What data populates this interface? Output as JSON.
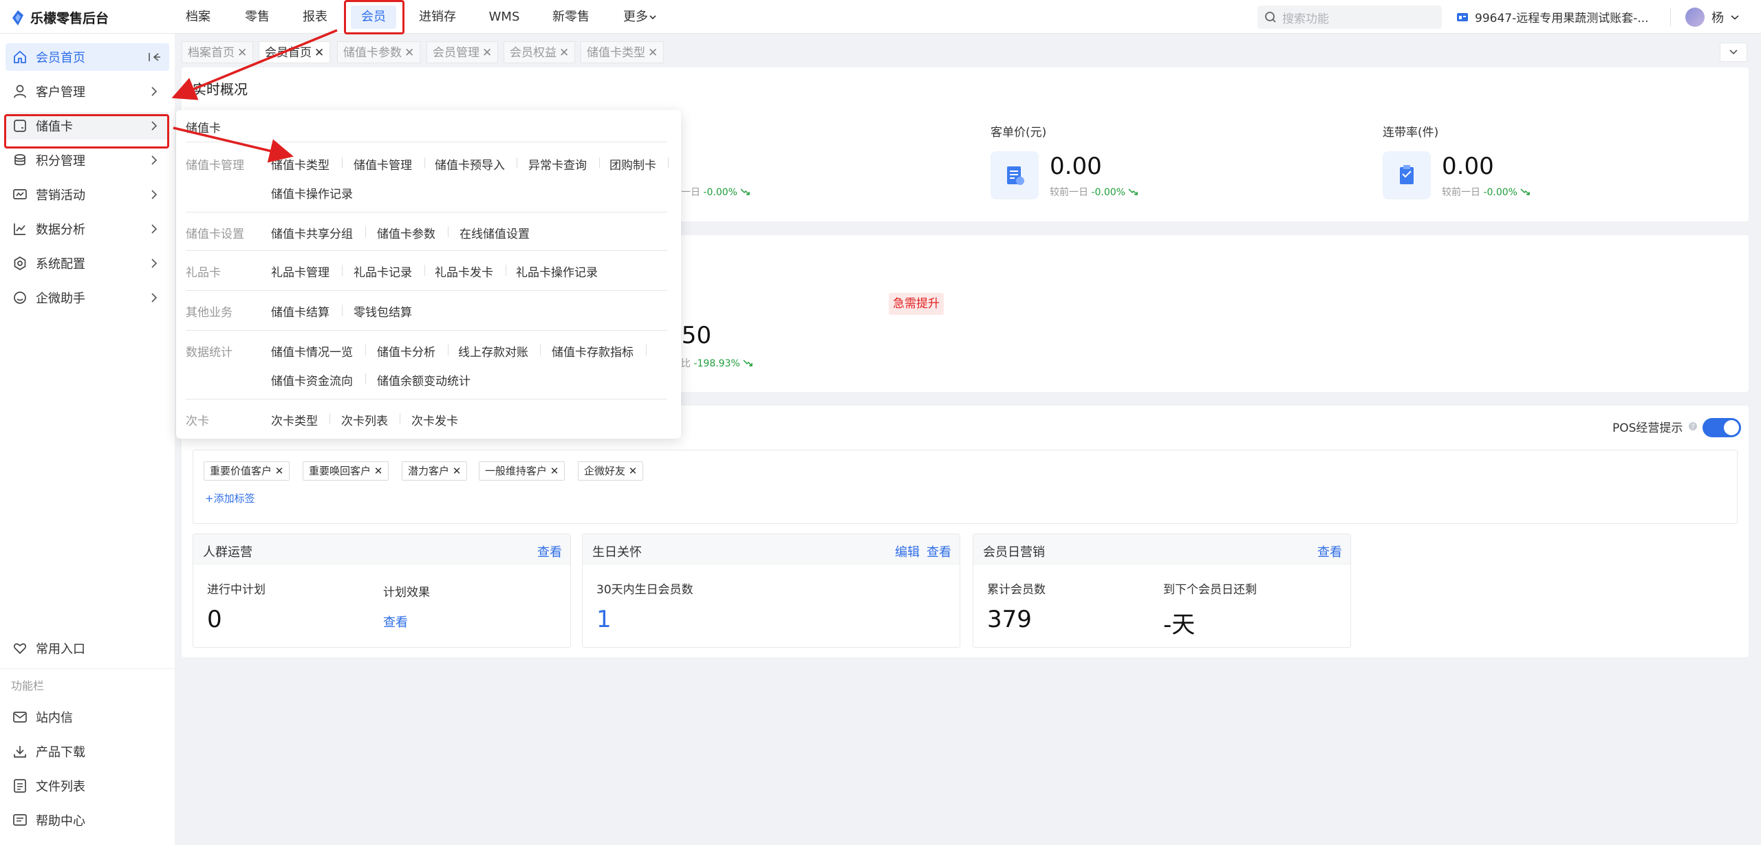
{
  "app": {
    "title": "乐檬零售后台"
  },
  "topnav": {
    "items": [
      {
        "label": "档案"
      },
      {
        "label": "零售"
      },
      {
        "label": "报表"
      },
      {
        "label": "会员"
      },
      {
        "label": "进销存"
      },
      {
        "label": "WMS"
      },
      {
        "label": "新零售"
      },
      {
        "label": "更多"
      }
    ],
    "active_index": 3
  },
  "search": {
    "placeholder": "搜索功能"
  },
  "store": {
    "name": "99647-远程专用果蔬测试账套-..."
  },
  "user": {
    "name": "杨"
  },
  "sidebar": {
    "items": [
      {
        "label": "会员首页",
        "icon": "home-icon"
      },
      {
        "label": "客户管理",
        "icon": "user-icon"
      },
      {
        "label": "储值卡",
        "icon": "wallet-icon"
      },
      {
        "label": "积分管理",
        "icon": "coins-icon"
      },
      {
        "label": "营销活动",
        "icon": "campaign-icon"
      },
      {
        "label": "数据分析",
        "icon": "chart-icon"
      },
      {
        "label": "系统配置",
        "icon": "settings-icon"
      },
      {
        "label": "企微助手",
        "icon": "chat-icon"
      }
    ],
    "common_entry": "常用入口",
    "func_label": "功能栏",
    "func_items": [
      {
        "label": "站内信"
      },
      {
        "label": "产品下载"
      },
      {
        "label": "文件列表"
      },
      {
        "label": "帮助中心"
      }
    ]
  },
  "tabs": [
    {
      "label": "档案首页"
    },
    {
      "label": "会员首页"
    },
    {
      "label": "储值卡参数"
    },
    {
      "label": "会员管理"
    },
    {
      "label": "会员权益"
    },
    {
      "label": "储值卡类型"
    }
  ],
  "overview": {
    "title": "实时概况",
    "stats": [
      {
        "label": "客单价(元)",
        "value": "0.00",
        "compare": "较前一日",
        "pct": "-0.00%"
      },
      {
        "label": "连带率(件)",
        "value": "0.00",
        "compare": "较前一日",
        "pct": "-0.00%"
      }
    ],
    "partial_compare": "一日",
    "partial_pct": "-0.00%"
  },
  "second_card": {
    "badge": "急需提升",
    "partial_value": ".50",
    "partial_compare": "比",
    "partial_pct": "-198.93%"
  },
  "tags_section": {
    "pos_tip": "POS经营提示",
    "tags": [
      "重要价值客户",
      "重要唤回客户",
      "潜力客户",
      "一般维持客户",
      "企微好友"
    ],
    "add_tag": "+添加标签"
  },
  "panels": {
    "crowd": {
      "title": "人群运营",
      "link": "查看",
      "running_label": "进行中计划",
      "running_value": "0",
      "effect_label": "计划效果",
      "effect_link": "查看"
    },
    "birthday": {
      "title": "生日关怀",
      "edit": "编辑",
      "link": "查看",
      "label": "30天内生日会员数",
      "value": "1"
    },
    "memberday": {
      "title": "会员日营销",
      "link": "查看",
      "total_label": "累计会员数",
      "total_value": "379",
      "next_label": "到下个会员日还剩",
      "next_value": "-天"
    }
  },
  "mega_menu": {
    "title": "储值卡",
    "groups": [
      {
        "category": "储值卡管理",
        "links": [
          "储值卡类型",
          "储值卡管理",
          "储值卡预导入",
          "异常卡查询",
          "团购制卡",
          "储值卡操作记录"
        ]
      },
      {
        "category": "储值卡设置",
        "links": [
          "储值卡共享分组",
          "储值卡参数",
          "在线储值设置"
        ]
      },
      {
        "category": "礼品卡",
        "links": [
          "礼品卡管理",
          "礼品卡记录",
          "礼品卡发卡",
          "礼品卡操作记录"
        ]
      },
      {
        "category": "其他业务",
        "links": [
          "储值卡结算",
          "零钱包结算"
        ]
      },
      {
        "category": "数据统计",
        "links": [
          "储值卡情况一览",
          "储值卡分析",
          "线上存款对账",
          "储值卡存款指标",
          "储值卡资金流向",
          "储值余额变动统计"
        ]
      },
      {
        "category": "次卡",
        "links": [
          "次卡类型",
          "次卡列表",
          "次卡发卡"
        ]
      }
    ]
  },
  "colors": {
    "accent": "#2f6ee6",
    "annotation": "#e02020",
    "positive": "#1f9d3a"
  }
}
